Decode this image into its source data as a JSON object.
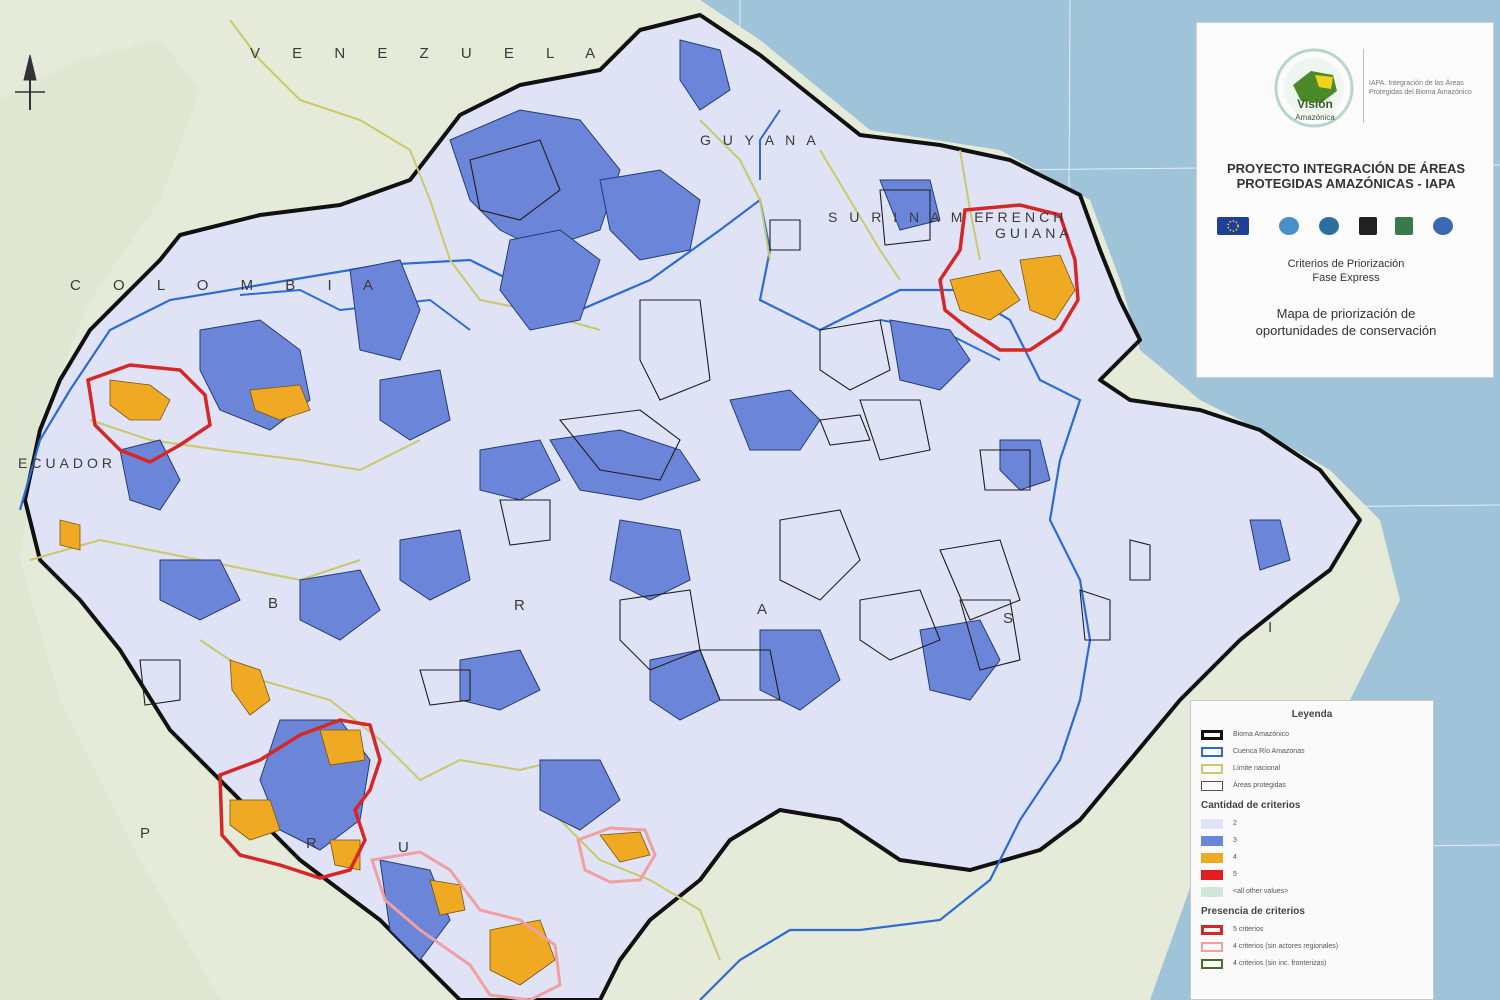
{
  "map": {
    "country_labels": {
      "venezuela": "V E N E Z U E L A",
      "guyana": "G U Y A N A",
      "suriname": "S U R I N A M E",
      "french_guiana_1": "FRENCH",
      "french_guiana_2": "GUIANA",
      "colombia": "C O L O M B I A",
      "ecuador": "ECUADOR",
      "brazil_b": "B",
      "brazil_r": "R",
      "brazil_a": "A",
      "brazil_s": "S",
      "peru_p": "P",
      "peru_r": "R",
      "peru_u": "U",
      "brazil_i": "I"
    },
    "colors": {
      "ocean": "#9fc3d8",
      "land": "#e6ead8",
      "criteria_2": "#dfe3f5",
      "criteria_3": "#6b86d8",
      "criteria_4": "#f0a923",
      "criteria_5": "#e31d1d",
      "biome_border": "#111111",
      "basin": "#2c6bd6",
      "national_limit": "#c9c96a",
      "highlight_5": "#d62727",
      "highlight_4": "#f0a0a0"
    }
  },
  "panel": {
    "logo_text": "Visión",
    "logo_sub": "Amazónica",
    "side_note": "IAPA. Integración de las Áreas Protegidas del Bioma Amazónico",
    "project_title": "PROYECTO INTEGRACIÓN DE ÁREAS PROTEGIDAS AMAZÓNICAS - IAPA",
    "criteria_title_1": "Criterios de Priorización",
    "criteria_title_2": "Fase Express",
    "map_title_1": "Mapa de priorización de",
    "map_title_2": "oportunidades de conservación",
    "partners": [
      "eu-flag-icon",
      "un-icon",
      "uicn-icon",
      "wwf-icon",
      "redparques-icon",
      "fao-icon"
    ]
  },
  "legend": {
    "title": "Leyenda",
    "lines": [
      {
        "label": "Bioma Amazónico"
      },
      {
        "label": "Cuenca Río Amazonas"
      },
      {
        "label": "Límite nacional"
      },
      {
        "label": "Áreas protegidas"
      }
    ],
    "criteria_heading": "Cantidad de criterios",
    "criteria": [
      {
        "label": "2"
      },
      {
        "label": "3"
      },
      {
        "label": "4"
      },
      {
        "label": "5"
      },
      {
        "label": "<all other values>"
      }
    ],
    "presence_heading": "Presencia de criterios",
    "presence": [
      {
        "label": "5 criterios"
      },
      {
        "label": "4 criterios (sin actores regionales)"
      },
      {
        "label": "4 criterios (sin inc. fronterizas)"
      }
    ]
  }
}
